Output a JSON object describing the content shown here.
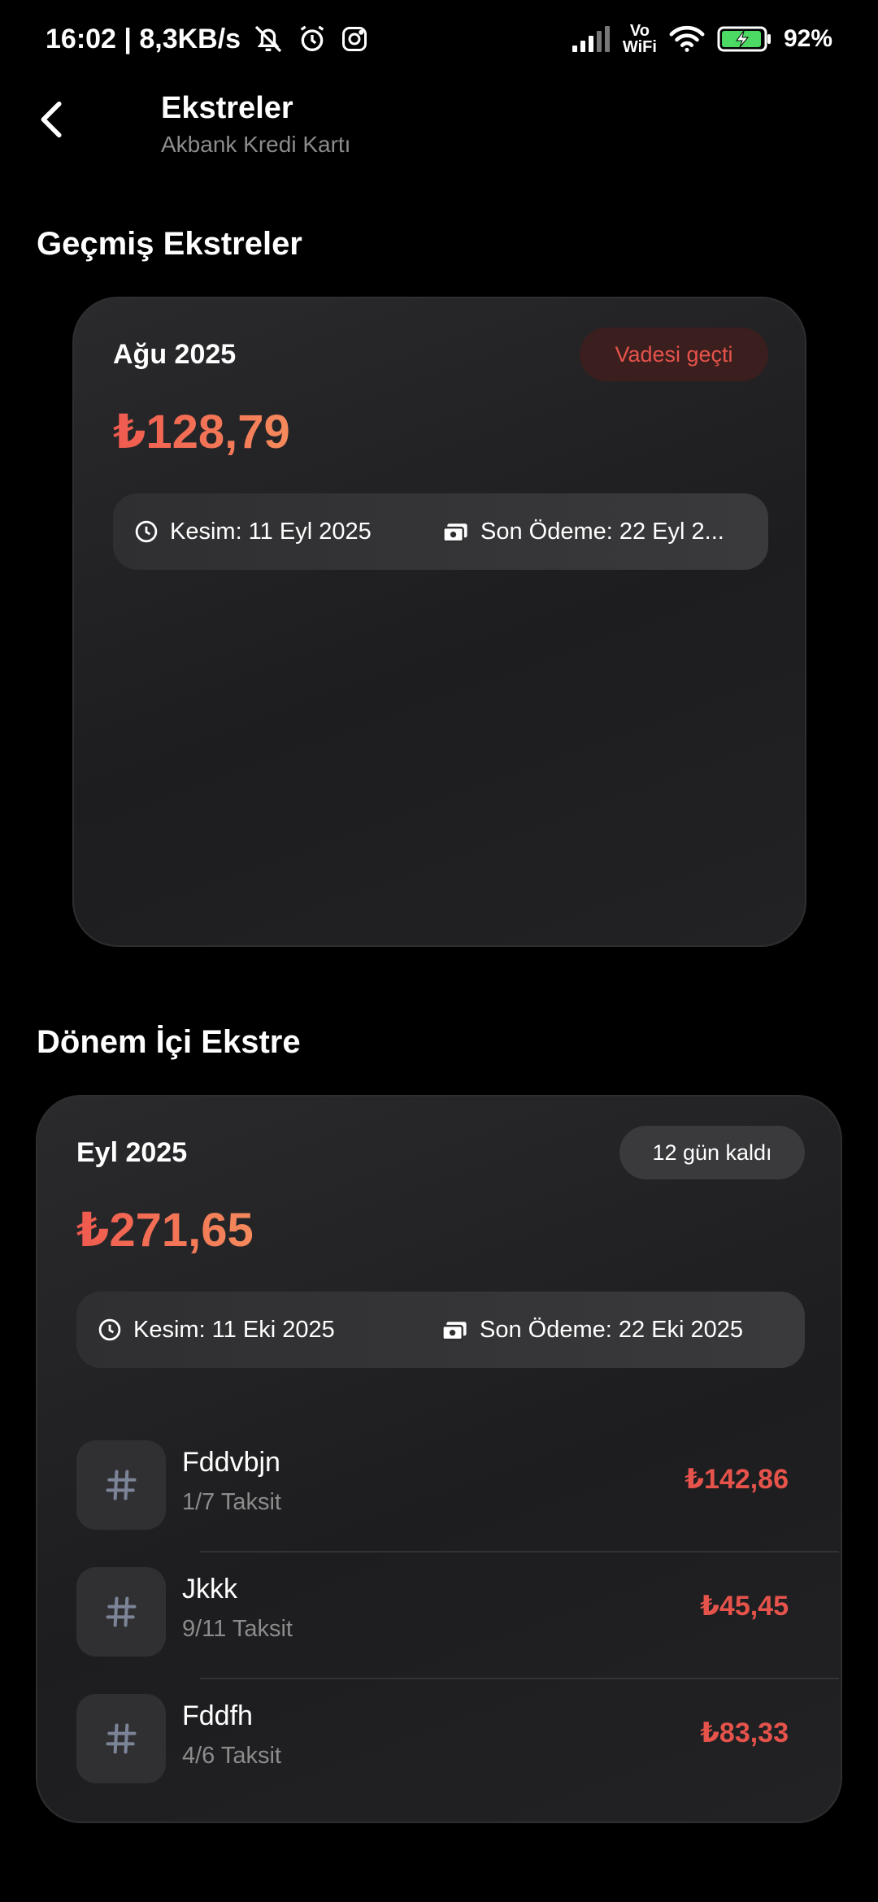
{
  "status_bar": {
    "time_speed": "16:02 | 8,3KB/s",
    "vowifi_top": "Vo",
    "vowifi_bottom": "WiFi",
    "battery": "92%"
  },
  "header": {
    "title": "Ekstreler",
    "subtitle": "Akbank Kredi Kartı"
  },
  "past_section": {
    "title": "Geçmiş Ekstreler",
    "statement": {
      "period": "Ağu 2025",
      "badge": "Vadesi geçti",
      "amount": "₺128,79",
      "cutoff": "Kesim: 11 Eyl 2025",
      "due": "Son Ödeme: 22 Eyl 2..."
    }
  },
  "current_section": {
    "title": "Dönem İçi Ekstre",
    "statement": {
      "period": "Eyl 2025",
      "badge": "12 gün kaldı",
      "amount": "₺271,65",
      "cutoff": "Kesim: 11 Eki 2025",
      "due": "Son Ödeme: 22 Eki 2025"
    },
    "transactions": [
      {
        "name": "Fddvbjn",
        "installment": "1/7 Taksit",
        "amount": "₺142,86"
      },
      {
        "name": "Jkkk",
        "installment": "9/11 Taksit",
        "amount": "₺45,45"
      },
      {
        "name": "Fddfh",
        "installment": "4/6 Taksit",
        "amount": "₺83,33"
      }
    ]
  },
  "colors": {
    "accent_red": "#e5534b",
    "amount_gradient_start": "#f05a4f",
    "amount_gradient_end": "#f58a5c",
    "background": "#000000"
  },
  "icons": {
    "back": "arrow-left-icon",
    "clock": "clock-icon",
    "payment": "cash-icon",
    "transaction": "hash-icon",
    "mute": "bell-off-icon",
    "alarm": "alarm-icon",
    "instagram": "instagram-icon",
    "signal": "signal-icon",
    "wifi": "wifi-icon",
    "battery": "battery-charging-icon"
  }
}
